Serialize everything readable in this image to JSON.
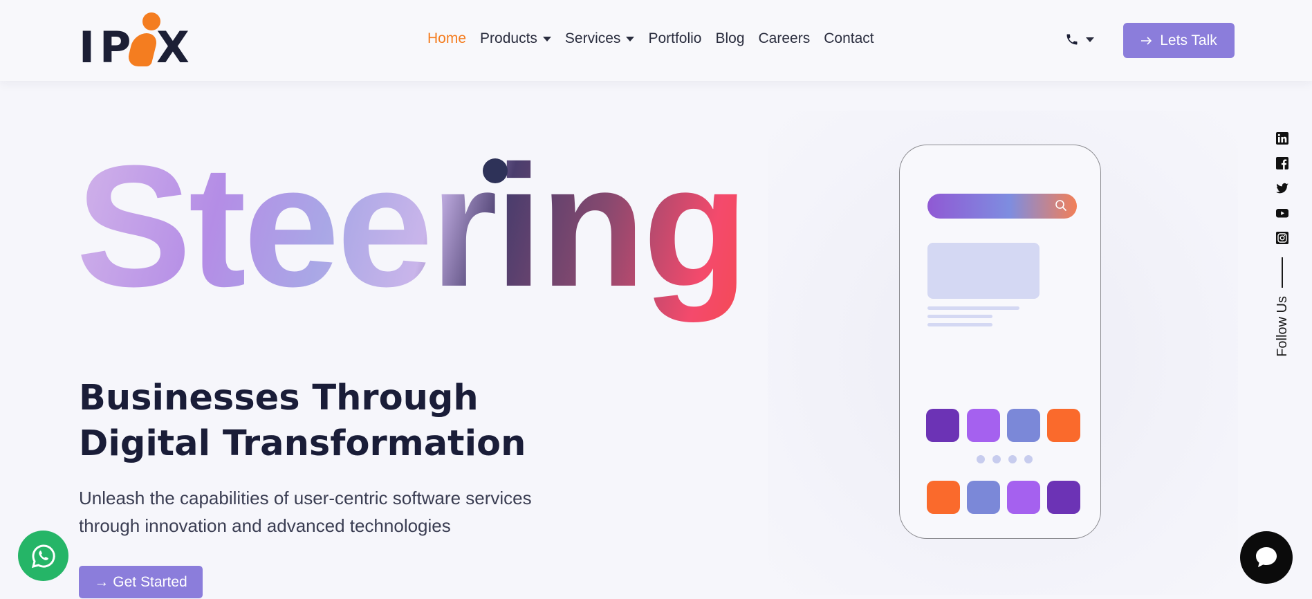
{
  "header": {
    "logo_text": "IPIX",
    "nav": [
      {
        "label": "Home",
        "active": true,
        "dropdown": false
      },
      {
        "label": "Products",
        "active": false,
        "dropdown": true
      },
      {
        "label": "Services",
        "active": false,
        "dropdown": true
      },
      {
        "label": "Portfolio",
        "active": false,
        "dropdown": false
      },
      {
        "label": "Blog",
        "active": false,
        "dropdown": false
      },
      {
        "label": "Careers",
        "active": false,
        "dropdown": false
      },
      {
        "label": "Contact",
        "active": false,
        "dropdown": false
      }
    ],
    "phone_icon": "phone-icon",
    "cta_label": "Lets Talk",
    "cta_icon": "arrow-right-icon"
  },
  "hero": {
    "big_word": "Steering",
    "title_line1": "Businesses Through",
    "title_line2": "Digital Transformation",
    "subtitle_line1": "Unleash the capabilities of user-centric software services",
    "subtitle_line2": "through innovation and advanced technologies",
    "button_label": "Get Started",
    "button_arrow": "→"
  },
  "social": {
    "follow_label": "Follow Us",
    "icons": [
      "linkedin-icon",
      "facebook-icon",
      "twitter-icon",
      "youtube-icon",
      "instagram-icon"
    ]
  },
  "colors": {
    "accent_orange": "#f47d20",
    "button_purple": "#8b7ddb",
    "dark_text": "#1a1d38",
    "whatsapp_green": "#25b567"
  }
}
